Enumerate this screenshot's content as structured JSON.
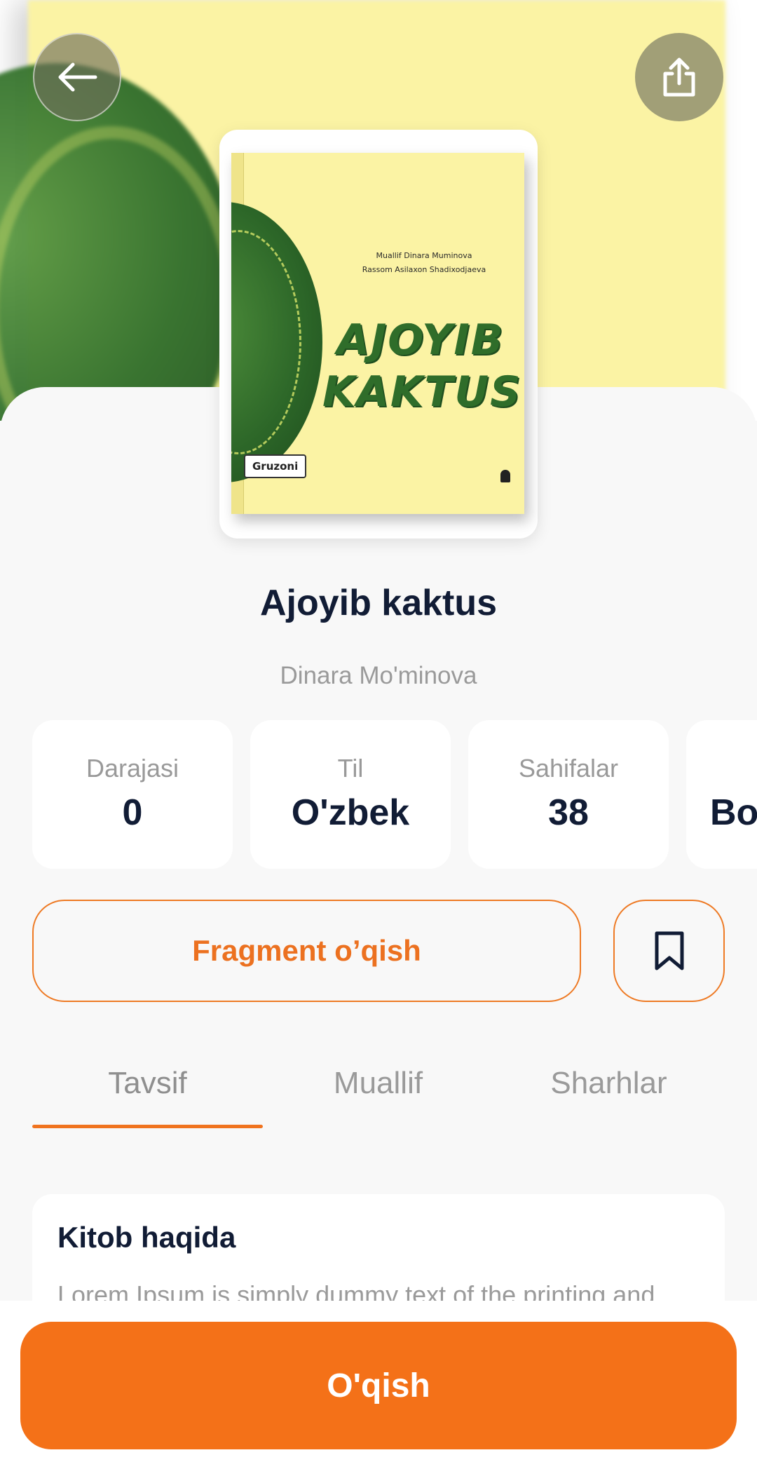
{
  "book": {
    "title": "Ajoyib kaktus",
    "author": "Dinara Mo'minova"
  },
  "cover": {
    "credit_line1": "Muallif Dinara Muminova",
    "credit_line2": "Rassom Asilaxon Shadixodjaeva",
    "title_line1": "AJOYIB",
    "title_line2": "KAKTUS",
    "publisher": "Gruzoni"
  },
  "stats": [
    {
      "label": "Darajasi",
      "value": "0"
    },
    {
      "label": "Til",
      "value": "O'zbek"
    },
    {
      "label": "Sahifalar",
      "value": "38"
    },
    {
      "label": "",
      "value": "Bo"
    }
  ],
  "actions": {
    "fragment_label": "Fragment o’qish",
    "read_label": "O'qish"
  },
  "tabs": [
    {
      "label": "Tavsif",
      "active": true
    },
    {
      "label": "Muallif",
      "active": false
    },
    {
      "label": "Sharhlar",
      "active": false
    }
  ],
  "about": {
    "title": "Kitob haqida",
    "text": "Lorem Ipsum is simply dummy text of the printing and"
  },
  "colors": {
    "accent": "#f47118",
    "title_text": "#111c35",
    "muted_text": "#9a9a9a",
    "cover_bg": "#fbf3a4",
    "leaf_green": "#2f6d2a"
  },
  "icons": {
    "back": "arrow-left-icon",
    "share": "share-icon",
    "bookmark": "bookmark-icon"
  }
}
